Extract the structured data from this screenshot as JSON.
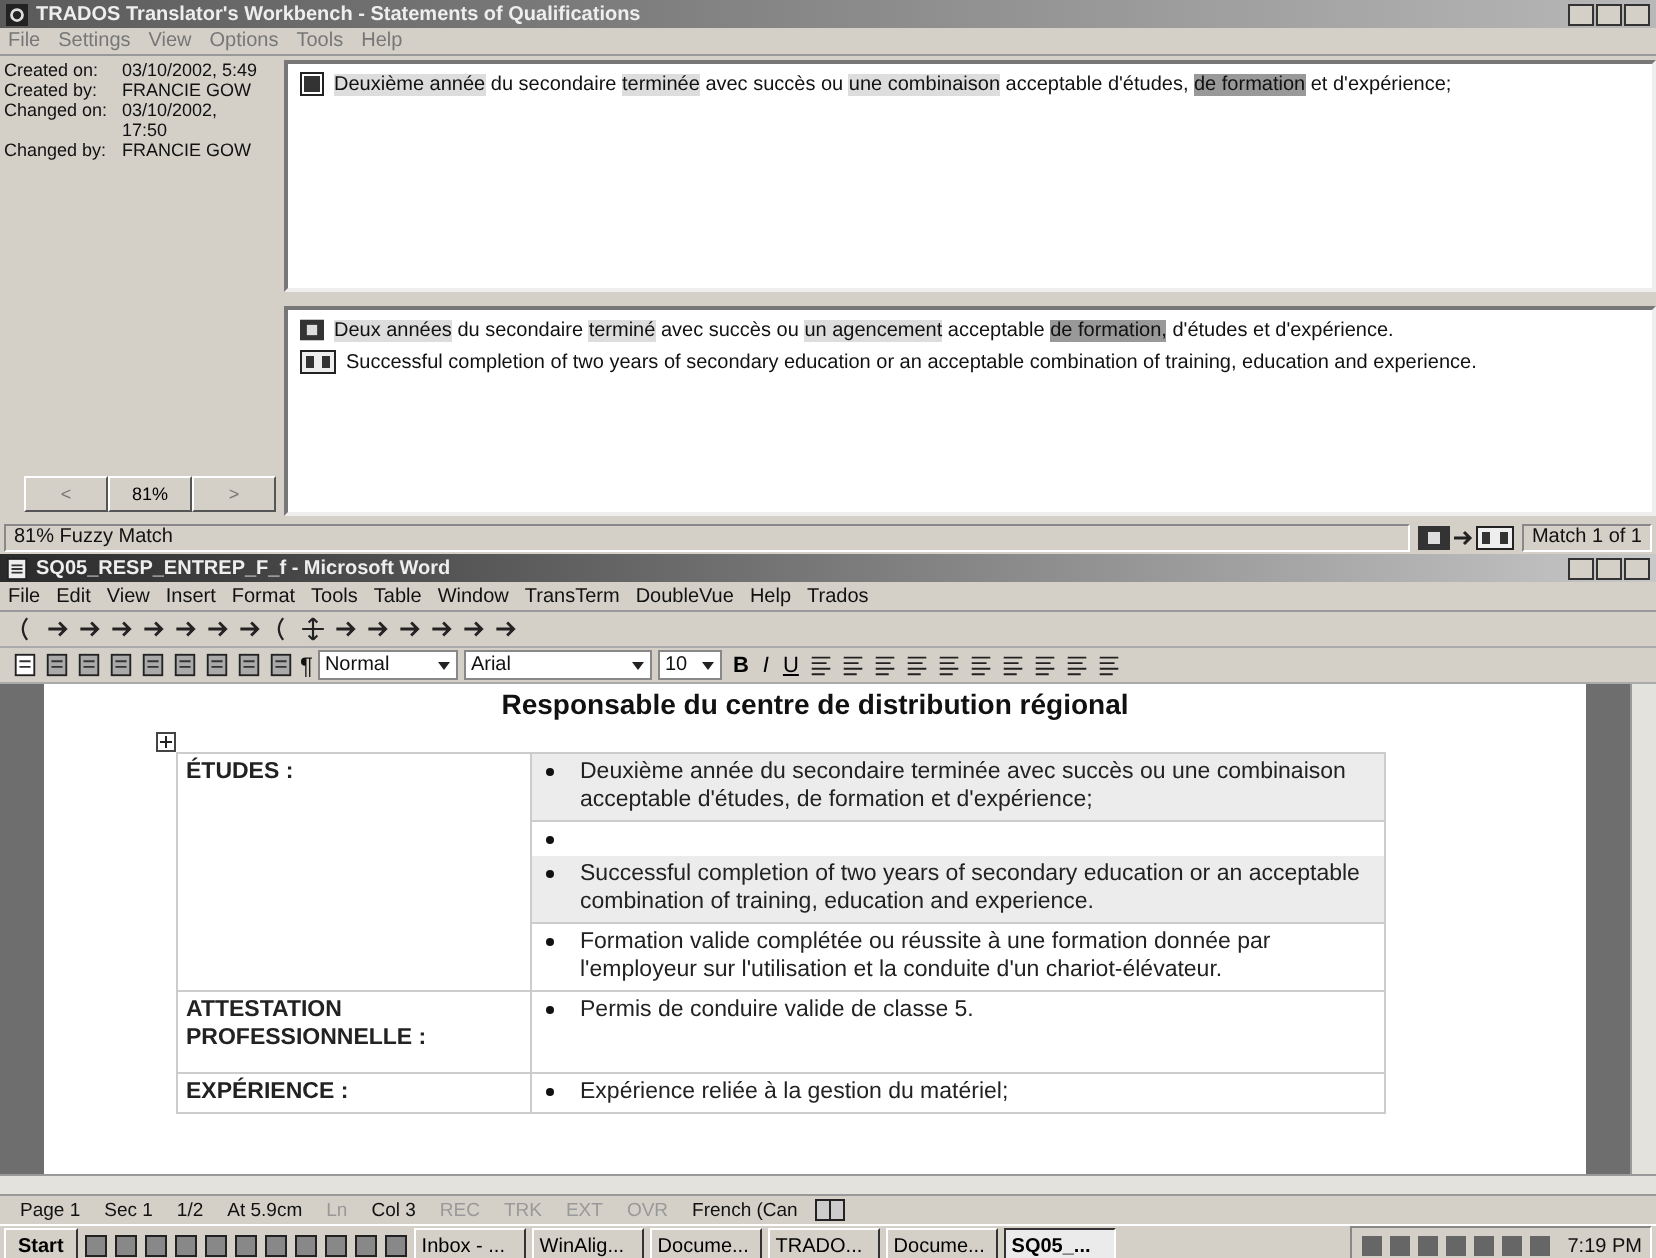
{
  "trados": {
    "title": "TRADOS Translator's Workbench - Statements of Qualifications",
    "menu": [
      "File",
      "Settings",
      "View",
      "Options",
      "Tools",
      "Help"
    ],
    "info": [
      {
        "label": "Created on:",
        "value": "03/10/2002, 5:49"
      },
      {
        "label": "Created by:",
        "value": "FRANCIE GOW"
      },
      {
        "label": "Changed on:",
        "value": "03/10/2002, 17:50"
      },
      {
        "label": "Changed by:",
        "value": "FRANCIE GOW"
      }
    ],
    "source": [
      {
        "text": "Deuxième année",
        "highlighted": true,
        "strong": false
      },
      {
        "text": "du secondaire",
        "highlighted": false,
        "strong": false
      },
      {
        "text": "terminée",
        "highlighted": true,
        "strong": false
      },
      {
        "text": "avec succès ou",
        "highlighted": false,
        "strong": false
      },
      {
        "text": "une combinaison",
        "highlighted": true,
        "strong": false
      },
      {
        "text": "acceptable d'études,",
        "highlighted": false,
        "strong": false
      },
      {
        "text": "de formation",
        "highlighted": true,
        "strong": true
      },
      {
        "text": "et d'expérience;",
        "highlighted": false,
        "strong": false
      }
    ],
    "match_source": [
      {
        "text": "Deux années",
        "highlighted": true,
        "strong": false
      },
      {
        "text": "du secondaire",
        "highlighted": false,
        "strong": false
      },
      {
        "text": "terminé",
        "highlighted": true,
        "strong": false
      },
      {
        "text": "avec succès ou",
        "highlighted": false,
        "strong": false
      },
      {
        "text": "un agencement",
        "highlighted": true,
        "strong": false
      },
      {
        "text": "acceptable",
        "highlighted": false,
        "strong": false
      },
      {
        "text": "de formation,",
        "highlighted": true,
        "strong": true
      },
      {
        "text": "d'études et d'expérience.",
        "highlighted": false,
        "strong": false
      }
    ],
    "match_target": "Successful completion of two years of secondary education or an acceptable combination of training, education and experience.",
    "nav": [
      {
        "label": "<",
        "disabled": true
      },
      {
        "label": "81%",
        "disabled": false
      },
      {
        "label": ">",
        "disabled": true
      }
    ],
    "status": {
      "match_type": "81% Fuzzy Match",
      "match_count": "Match 1 of 1"
    }
  },
  "word": {
    "title": "SQ05_RESP_ENTREP_F_f - Microsoft Word",
    "menu": [
      "File",
      "Edit",
      "View",
      "Insert",
      "Format",
      "Tools",
      "Table",
      "Window",
      "TransTerm",
      "DoubleVue",
      "Help",
      "Trados"
    ],
    "format": {
      "style": "Normal",
      "font": "Arial",
      "size": "10"
    },
    "paragraph_mark": "¶",
    "format_buttons": [
      "B",
      "I",
      "U"
    ],
    "heading": "Responsable du centre de distribution régional",
    "rows": [
      {
        "label": "ÉTUDES :",
        "items": [
          {
            "text": "Deuxième année du secondaire terminée avec succès ou une combinaison acceptable d'études, de formation et d'expérience;",
            "shaded": true
          },
          {
            "shaded": false
          },
          {
            "text": "Successful completion of two years of secondary education or an acceptable combination of training, education and experience.",
            "shaded": true
          },
          {
            "text": "Formation valide complétée ou réussite à une formation donnée par l'employeur sur l'utilisation et la conduite d'un chariot-élévateur.",
            "shaded": false
          }
        ]
      },
      {
        "label": "ATTESTATION PROFESSIONNELLE :",
        "items": [
          {
            "text": "Permis de conduire valide de classe 5.",
            "shaded": false
          }
        ]
      },
      {
        "label": "EXPÉRIENCE :",
        "items": [
          {
            "text": "Expérience reliée à la gestion du matériel;",
            "shaded": false
          }
        ]
      }
    ],
    "status": [
      {
        "text": "Page 1",
        "disabled": false
      },
      {
        "text": "Sec 1",
        "disabled": false
      },
      {
        "text": "1/2",
        "disabled": false
      },
      {
        "text": "At 5.9cm",
        "disabled": false
      },
      {
        "text": "Ln",
        "disabled": true
      },
      {
        "text": "Col 3",
        "disabled": false
      },
      {
        "text": "REC",
        "disabled": true
      },
      {
        "text": "TRK",
        "disabled": true
      },
      {
        "text": "EXT",
        "disabled": true
      },
      {
        "text": "OVR",
        "disabled": true
      },
      {
        "text": "French (Can",
        "disabled": false
      }
    ]
  },
  "taskbar": {
    "start": "Start",
    "tasks": [
      {
        "label": "Inbox - ...",
        "selected": false
      },
      {
        "label": "WinAlig...",
        "selected": false
      },
      {
        "label": "Docume...",
        "selected": false
      },
      {
        "label": "TRADO...",
        "selected": false
      },
      {
        "label": "Docume...",
        "selected": false
      },
      {
        "label": "SQ05_...",
        "selected": true
      }
    ],
    "clock": "7:19 PM"
  }
}
